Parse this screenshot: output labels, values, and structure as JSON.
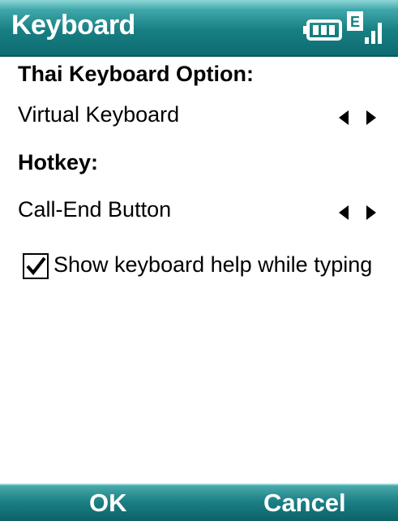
{
  "title_bar": {
    "title": "Keyboard",
    "status": {
      "battery_icon": "battery-icon",
      "network_badge": "E",
      "signal_icon": "signal-strength-icon"
    }
  },
  "sections": [
    {
      "label": "Thai Keyboard Option:",
      "value": "Virtual Keyboard"
    },
    {
      "label": "Hotkey:",
      "value": "Call-End Button"
    }
  ],
  "options": {
    "show_help": {
      "label": "Show keyboard help while typing",
      "checked": true
    }
  },
  "softkeys": {
    "left": "OK",
    "right": "Cancel"
  },
  "colors": {
    "title_bar": "#177f83",
    "softkey_bar": "#1c8085",
    "text": "#000000",
    "title_text": "#ffffff"
  }
}
